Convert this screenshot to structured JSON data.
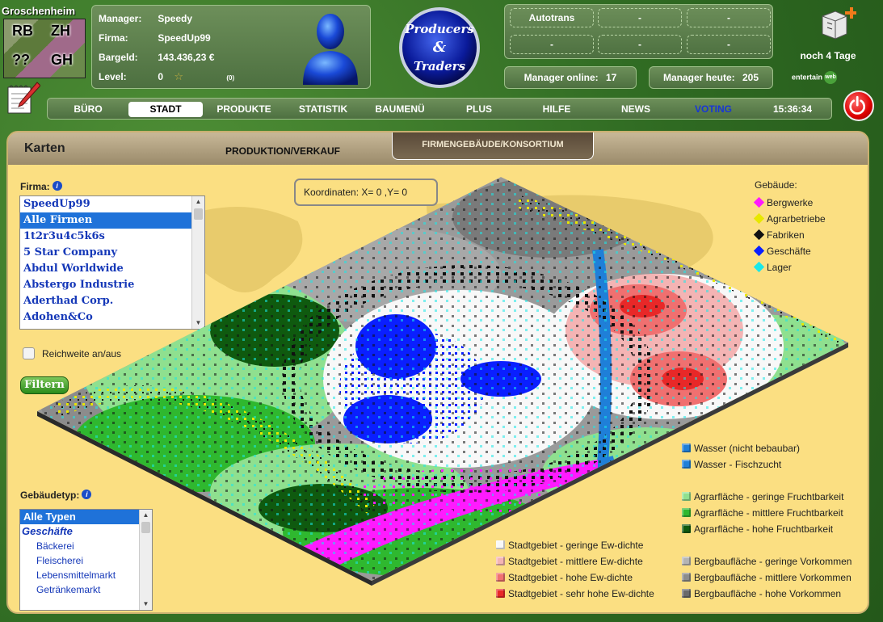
{
  "city": {
    "name": "Groschenheim",
    "codes": [
      "RB",
      "ZH",
      "??",
      "GH"
    ]
  },
  "manager": {
    "name_label": "Manager:",
    "name": "Speedy",
    "company_label": "Firma:",
    "company": "SpeedUp99",
    "cash_label": "Bargeld:",
    "cash": "143.436,23 €",
    "level_label": "Level:",
    "level": "0",
    "level_star": "☆",
    "level_count": "(0)"
  },
  "logo": {
    "line1": "Producers",
    "line2": "&",
    "line3": "Traders"
  },
  "slots": [
    "Autotrans",
    "-",
    "-",
    "-",
    "-",
    "-"
  ],
  "stats": {
    "online_label": "Manager online:",
    "online": "17",
    "today_label": "Manager heute:",
    "today": "205"
  },
  "days_left": "noch 4 Tage",
  "entertain": {
    "text": "entertain",
    "badge": "web"
  },
  "nav": {
    "items": [
      {
        "label": "BÜRO"
      },
      {
        "label": "STADT"
      },
      {
        "label": "PRODUKTE"
      },
      {
        "label": "STATISTIK"
      },
      {
        "label": "BAUMENÜ"
      },
      {
        "label": "PLUS"
      },
      {
        "label": "HILFE"
      },
      {
        "label": "NEWS"
      },
      {
        "label": "VOTING"
      }
    ],
    "active": "STADT",
    "clock": "15:36:34"
  },
  "panel": {
    "title": "Karten",
    "tab_production": "PRODUKTION/VERKAUF",
    "tab_buildings": "FIRMENGEBÄUDE/KONSORTIUM"
  },
  "firm_filter": {
    "label": "Firma:",
    "info": "i",
    "items": [
      "SpeedUp99",
      "Alle Firmen",
      "1t2r3u4c5k6s",
      "5 Star Company",
      "Abdul Worldwide",
      "Abstergo Industrie",
      "Aderthad Corp.",
      "Adohen&Co"
    ],
    "selected": "Alle Firmen",
    "range_toggle": "Reichweite an/aus",
    "filter_button": "Filtern"
  },
  "building_type": {
    "label": "Gebäudetyp:",
    "info": "i",
    "items": [
      {
        "label": "Alle Typen",
        "kind": "selected"
      },
      {
        "label": "Geschäfte",
        "kind": "group"
      },
      {
        "label": "Bäckerei",
        "kind": "sub"
      },
      {
        "label": "Fleischerei",
        "kind": "sub"
      },
      {
        "label": "Lebensmittelmarkt",
        "kind": "sub"
      },
      {
        "label": "Getränkemarkt",
        "kind": "sub"
      }
    ]
  },
  "coordinates": "Koordinaten: X= 0 ,Y= 0",
  "legend": {
    "buildings_title": "Gebäude:",
    "buildings": [
      {
        "label": "Bergwerke",
        "color": "#ff1aff"
      },
      {
        "label": "Agrarbetriebe",
        "color": "#e8e800"
      },
      {
        "label": "Fabriken",
        "color": "#111111"
      },
      {
        "label": "Geschäfte",
        "color": "#0a1fff"
      },
      {
        "label": "Lager",
        "color": "#1ae8e8"
      }
    ],
    "water": [
      {
        "label": "Wasser (nicht bebaubar)",
        "color": "#1f7fd8"
      },
      {
        "label": "Wasser - Fischzucht",
        "color": "#1f7fd8"
      }
    ],
    "agri": [
      {
        "label": "Agrarfläche - geringe Fruchtbarkeit",
        "color": "#8fe08f"
      },
      {
        "label": "Agrarfläche - mittlere Fruchtbarkeit",
        "color": "#2fb82f"
      },
      {
        "label": "Agrarfläche - hohe Fruchtbarkeit",
        "color": "#0f5a0f"
      }
    ],
    "urban": [
      {
        "label": "Stadtgebiet - geringe Ew-dichte",
        "color": "#f8f8f8"
      },
      {
        "label": "Stadtgebiet - mittlere Ew-dichte",
        "color": "#f4b4b4"
      },
      {
        "label": "Stadtgebiet - hohe Ew-dichte",
        "color": "#f07070"
      },
      {
        "label": "Stadtgebiet - sehr hohe Ew-dichte",
        "color": "#e82828"
      }
    ],
    "mining": [
      {
        "label": "Bergbaufläche - geringe Vorkommen",
        "color": "#b4b4b4"
      },
      {
        "label": "Bergbaufläche - mittlere Vorkommen",
        "color": "#8c8c8c"
      },
      {
        "label": "Bergbaufläche - hohe Vorkommen",
        "color": "#6a6a6a"
      }
    ]
  }
}
